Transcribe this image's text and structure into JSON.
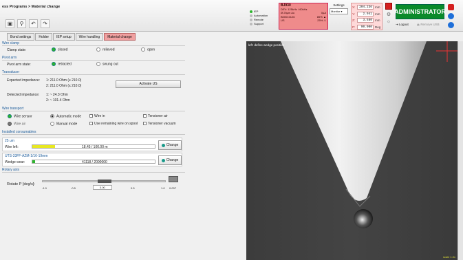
{
  "breadcrumb": "ess Programs > Material change",
  "status": {
    "items": [
      {
        "label": "IEP",
        "on": true
      },
      {
        "label": "Automation",
        "on": false
      },
      {
        "label": "Remote",
        "on": false
      },
      {
        "label": "Support",
        "on": false
      }
    ]
  },
  "machine": {
    "title": "BJ930",
    "lines": [
      {
        "left": "DEV: 125kHz / 60kHz",
        "right": ""
      },
      {
        "left": "Ø 25µm Au",
        "right": "0µA"
      },
      {
        "left": "B00010126",
        "right": "85% ▲"
      },
      {
        "left": "US",
        "right": "25% ⚠"
      }
    ]
  },
  "settings": {
    "label": "Settings",
    "selected": "Monitor"
  },
  "coords": [
    {
      "axis": "X:",
      "value": "204.236",
      "unit": "mm"
    },
    {
      "axis": "Y:",
      "value": "2.941",
      "unit": "mm"
    },
    {
      "axis": "Z:",
      "value": "3.580",
      "unit": "mm"
    },
    {
      "axis": "P:",
      "value": "90.000",
      "unit": "Deg"
    }
  ],
  "user": {
    "name": "ADMINISTRATOR",
    "logout": "Logout",
    "remove_usb": "Remove USB"
  },
  "tabs": [
    "Bond settings",
    "Holder",
    "IEP setup",
    "Wire handling",
    "Material change"
  ],
  "active_tab": 4,
  "wire_clamp": {
    "section": "Wire clamp",
    "label": "Clamp state:",
    "options": [
      "closed",
      "relieved",
      "open"
    ]
  },
  "pivot_arm": {
    "section": "Pivot arm",
    "label": "Pivot arm state:",
    "options": [
      "retracted",
      "swung out"
    ]
  },
  "transducer": {
    "section": "Transducer",
    "expected_label": "Expected impedance:",
    "expected_1": "1: 211.0 Ohm (≤ 210.0)",
    "expected_2": "2: 211.0 Ohm (≤ 210.0)",
    "detected_label": "Detected impedance:",
    "detected_1": "1: ~ 24.3 Ohm",
    "detected_2": "2: ~ 101.4 Ohm",
    "activate_button": "Activate US"
  },
  "wire_transport": {
    "section": "Wire transport",
    "row1": [
      "Wire sensor",
      "Automatic mode",
      "Wire in",
      "Tensioner air"
    ],
    "row2": [
      "Wire air",
      "Manual mode",
      "Use remaining wire on spool",
      "Tensioner vacuum"
    ]
  },
  "consumables": {
    "section": "Installed consumables",
    "wire": {
      "name": "25 um",
      "label": "Wire left:",
      "value": "18.45 / 100.00 m",
      "fraction": 0.1845,
      "color": "#e8e820"
    },
    "wedge": {
      "name": "UTS-33FF-AZM-1/16-19mm",
      "label": "Wedge wear:",
      "value": "41118 / 2000000",
      "fraction": 0.0206,
      "color": "#2db52d"
    },
    "change": "Change"
  },
  "rotary": {
    "section": "Rotary axis",
    "label": "Rotate P [deg/s]:",
    "ticks": [
      "-1.0",
      "-0.5",
      "0.00",
      "0.5",
      "1.0"
    ],
    "value": "0.00",
    "extra": "0.007"
  },
  "camera": {
    "label": "left: define wedge position",
    "scale": "scale 1.0x"
  }
}
